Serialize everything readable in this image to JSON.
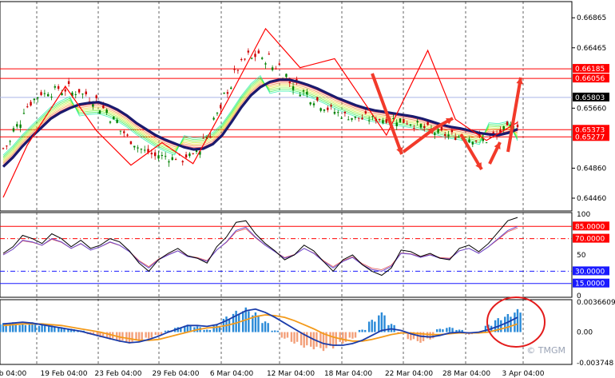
{
  "chart_data": [
    {
      "type": "line",
      "panel": "price",
      "ylim": [
        0.643,
        0.6707
      ],
      "y_ticks": [
        "0.66865",
        "0.66465",
        "0.66056",
        "0.65803",
        "0.65660",
        "0.65373",
        "0.65277",
        "0.64860",
        "0.64460"
      ],
      "highlight_levels": [
        {
          "label": "0.66185",
          "value": 0.66185,
          "color": "#ff0000",
          "box": "#ff0000"
        },
        {
          "label": "0.66056",
          "value": 0.66056,
          "color": "#ff0000",
          "box": "#ff0000"
        },
        {
          "label": "0.65803",
          "value": 0.65803,
          "color": "#aab4e6",
          "box": "#000000"
        },
        {
          "label": "0.65373",
          "value": 0.65373,
          "color": "#ff0000",
          "box": "#ff0000"
        },
        {
          "label": "0.65277",
          "value": 0.65277,
          "color": "#ff0000",
          "box": "#ff0000"
        }
      ],
      "x_labels": [
        "b 04:00",
        "19 Feb 04:00",
        "23 Feb 04:00",
        "29 Feb 04:00",
        "6 Mar 04:00",
        "12 Mar 04:00",
        "18 Mar 04:00",
        "22 Mar 04:00",
        "28 Mar 04:00",
        "3 Apr 04:00"
      ],
      "series": [
        {
          "values": [
            0.6488,
            0.65,
            0.6515,
            0.6528,
            0.654,
            0.6552,
            0.656,
            0.6566,
            0.6571,
            0.6573,
            0.6574,
            0.657,
            0.6564,
            0.6556,
            0.6546,
            0.6538,
            0.653,
            0.6524,
            0.6519,
            0.6514,
            0.6511,
            0.6512,
            0.6518,
            0.653,
            0.6548,
            0.6567,
            0.6583,
            0.6594,
            0.6601,
            0.6604,
            0.6604,
            0.6601,
            0.6597,
            0.6592,
            0.6586,
            0.658,
            0.6575,
            0.657,
            0.6566,
            0.6563,
            0.6561,
            0.6559,
            0.6557,
            0.6555,
            0.6552,
            0.6548,
            0.6544,
            0.6541,
            0.6539,
            0.6536,
            0.6533,
            0.6531,
            0.653,
            0.6533,
            0.6538
          ]
        }
      ],
      "bounds": {
        "top": [
          0,
          15,
          15,
          17,
          17,
          18,
          18,
          16,
          16,
          17,
          19
        ]
      },
      "annotations": [
        "zigzag",
        "arrows"
      ]
    },
    {
      "type": "line",
      "panel": "oscillator",
      "ylim": [
        0,
        100
      ],
      "y_ticks": [
        "100",
        "50",
        "0"
      ],
      "levels": [
        {
          "label": "85.0000",
          "value": 85,
          "color": "#ff0000",
          "style": "solid"
        },
        {
          "label": "70.0000",
          "value": 70,
          "color": "#ff0000",
          "style": "dashdot"
        },
        {
          "label": "30.0000",
          "value": 30,
          "color": "#1a1aff",
          "style": "dashdot"
        },
        {
          "label": "15.0000",
          "value": 15,
          "color": "#1a1aff",
          "style": "solid"
        }
      ],
      "series": [
        {
          "values": [
            52,
            60,
            74,
            70,
            64,
            76,
            70,
            60,
            68,
            58,
            62,
            70,
            66,
            55,
            40,
            30,
            44,
            52,
            58,
            49,
            46,
            40,
            60,
            72,
            90,
            92,
            76,
            64,
            55,
            44,
            50,
            62,
            55,
            42,
            30,
            44,
            50,
            38,
            30,
            25,
            34,
            56,
            54,
            48,
            52,
            46,
            44,
            58,
            62,
            54,
            64,
            78,
            92,
            96
          ]
        },
        {
          "values": [
            50,
            57,
            68,
            66,
            62,
            70,
            66,
            58,
            64,
            56,
            60,
            66,
            62,
            54,
            42,
            34,
            44,
            50,
            55,
            48,
            46,
            42,
            56,
            66,
            80,
            84,
            72,
            62,
            54,
            46,
            50,
            58,
            52,
            42,
            34,
            42,
            47,
            38,
            32,
            30,
            36,
            52,
            51,
            47,
            50,
            46,
            45,
            55,
            58,
            52,
            60,
            70,
            80,
            85
          ]
        }
      ]
    },
    {
      "type": "bar",
      "panel": "macd",
      "ylim": [
        -0.003748,
        0.0036609
      ],
      "y_ticks": [
        "0.0036609",
        "0.00",
        "-0.003748"
      ],
      "histogram": [
        0.0011,
        0.0012,
        0.001,
        0.0012,
        0.0009,
        0.0008,
        0.0006,
        0.0004,
        0.0002,
        -0.0003,
        -0.0006,
        -0.0009,
        -0.0012,
        -0.0014,
        -0.0012,
        -0.0008,
        -0.0004,
        0.0002,
        0.0006,
        0.0009,
        0.0007,
        0.0003,
        0.0009,
        0.0019,
        0.0026,
        0.003,
        0.0024,
        0.0013,
        0.0002,
        -0.0008,
        -0.0014,
        -0.0019,
        -0.0021,
        -0.0023,
        -0.002,
        -0.0014,
        -0.0008,
        0.0003,
        0.0015,
        0.0024,
        0.001,
        -0.0002,
        -0.001,
        -0.0013,
        -0.0009,
        0.0004,
        0.0006,
        0.0003,
        -0.0003,
        0.0,
        0.0009,
        0.0017,
        0.0022,
        0.0028
      ],
      "series": [
        {
          "values": [
            0.001,
            0.0011,
            0.0012,
            0.0011,
            0.0009,
            0.0007,
            0.0005,
            0.0003,
            0.0001,
            -0.0002,
            -0.0005,
            -0.0008,
            -0.0011,
            -0.0013,
            -0.0012,
            -0.0009,
            -0.0005,
            0.0,
            0.0004,
            0.0008,
            0.0008,
            0.0007,
            0.0009,
            0.0014,
            0.002,
            0.0026,
            0.0028,
            0.0024,
            0.0018,
            0.0011,
            0.0004,
            -0.0003,
            -0.0009,
            -0.0014,
            -0.0016,
            -0.0016,
            -0.0014,
            -0.001,
            -0.0004,
            0.0002,
            0.0004,
            0.0002,
            -0.0002,
            -0.0005,
            -0.0006,
            -0.0004,
            -0.0001,
            0.0,
            -0.0001,
            0.0,
            0.0003,
            0.0007,
            0.0012,
            0.0018
          ]
        },
        {
          "values": [
            0.0008,
            0.0009,
            0.001,
            0.001,
            0.001,
            0.0009,
            0.0008,
            0.0006,
            0.0004,
            0.0002,
            0.0,
            -0.0003,
            -0.0006,
            -0.0008,
            -0.001,
            -0.001,
            -0.0009,
            -0.0006,
            -0.0003,
            0.0,
            0.0003,
            0.0005,
            0.0006,
            0.0008,
            0.0011,
            0.0015,
            0.0019,
            0.0021,
            0.002,
            0.0018,
            0.0014,
            0.0009,
            0.0004,
            -0.0002,
            -0.0006,
            -0.0009,
            -0.0011,
            -0.0011,
            -0.0009,
            -0.0006,
            -0.0003,
            -0.0001,
            -0.0001,
            -0.0002,
            -0.0003,
            -0.0003,
            -0.0002,
            -0.0001,
            -0.0001,
            -0.0001,
            0.0,
            0.0003,
            0.0006,
            0.001
          ]
        }
      ]
    }
  ],
  "watermark": "© TMGM",
  "colors": {
    "ma": "#1a1a6e",
    "candle_up": "#008000",
    "candle_down": "#cc0000",
    "level_red": "#ff0000",
    "macd_pos": "#2a8ad8",
    "macd_neg": "#f3a07a",
    "macd_line": "#1a3caa",
    "signal_line": "#f39a1a",
    "osc_main": "#000000",
    "osc_signal": "#6a4ad0"
  }
}
